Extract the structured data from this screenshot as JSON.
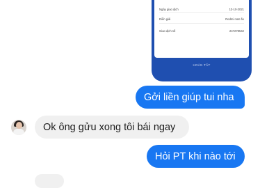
{
  "receipt": {
    "rows": [
      {
        "label": "Ngày giao dịch",
        "value": "13-10-2021"
      },
      {
        "label": "Diễn giải",
        "value": "Redmi note fix"
      },
      {
        "label": "Giao dịch số",
        "value": "247278542"
      }
    ],
    "done_label": "HOÀN TẤT"
  },
  "messages": [
    {
      "sender": "me",
      "text": "Gởi liền giúp tui nha"
    },
    {
      "sender": "other",
      "text": "Ok ông gửu xong tôi bái ngay"
    },
    {
      "sender": "me",
      "text": "Hỏi PT khi nào tới"
    }
  ],
  "colors": {
    "outgoing": "#1877f2",
    "incoming": "#f0f0f0",
    "receipt_bg": "#1f4fb0"
  }
}
